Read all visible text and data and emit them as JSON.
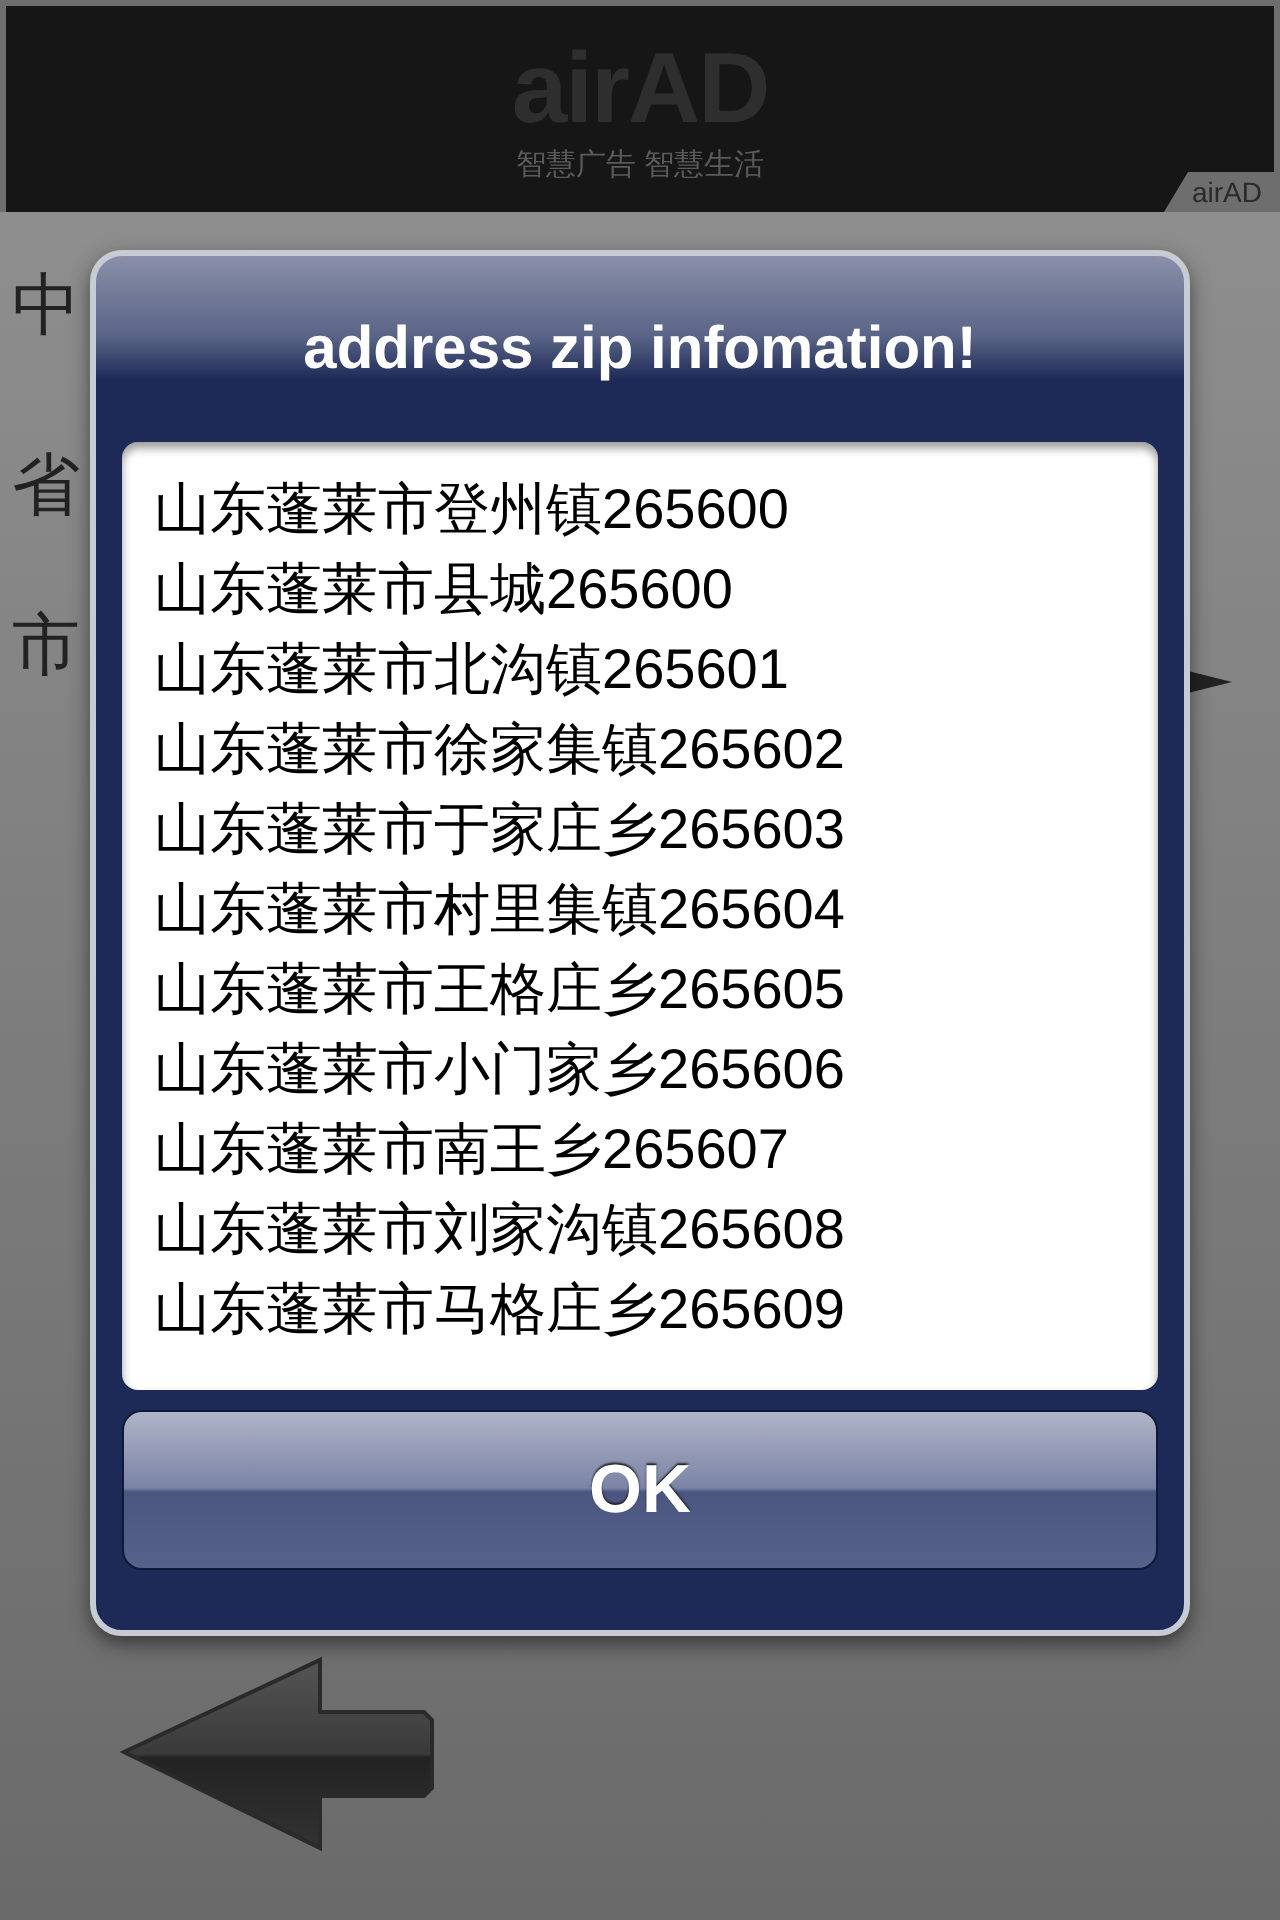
{
  "ad_banner": {
    "logo": "airAD",
    "tagline": "智慧广告 智慧生活",
    "corner_tag": "airAD"
  },
  "background": {
    "title": "中",
    "labels": [
      "省",
      "市"
    ]
  },
  "dialog": {
    "title": "address zip infomation!",
    "items": [
      "山东蓬莱市登州镇265600",
      "山东蓬莱市县城265600",
      "山东蓬莱市北沟镇265601",
      "山东蓬莱市徐家集镇265602",
      "山东蓬莱市于家庄乡265603",
      "山东蓬莱市村里集镇265604",
      "山东蓬莱市王格庄乡265605",
      "山东蓬莱市小门家乡265606",
      "山东蓬莱市南王乡265607",
      "山东蓬莱市刘家沟镇265608",
      "山东蓬莱市马格庄乡265609"
    ],
    "button": "OK"
  }
}
